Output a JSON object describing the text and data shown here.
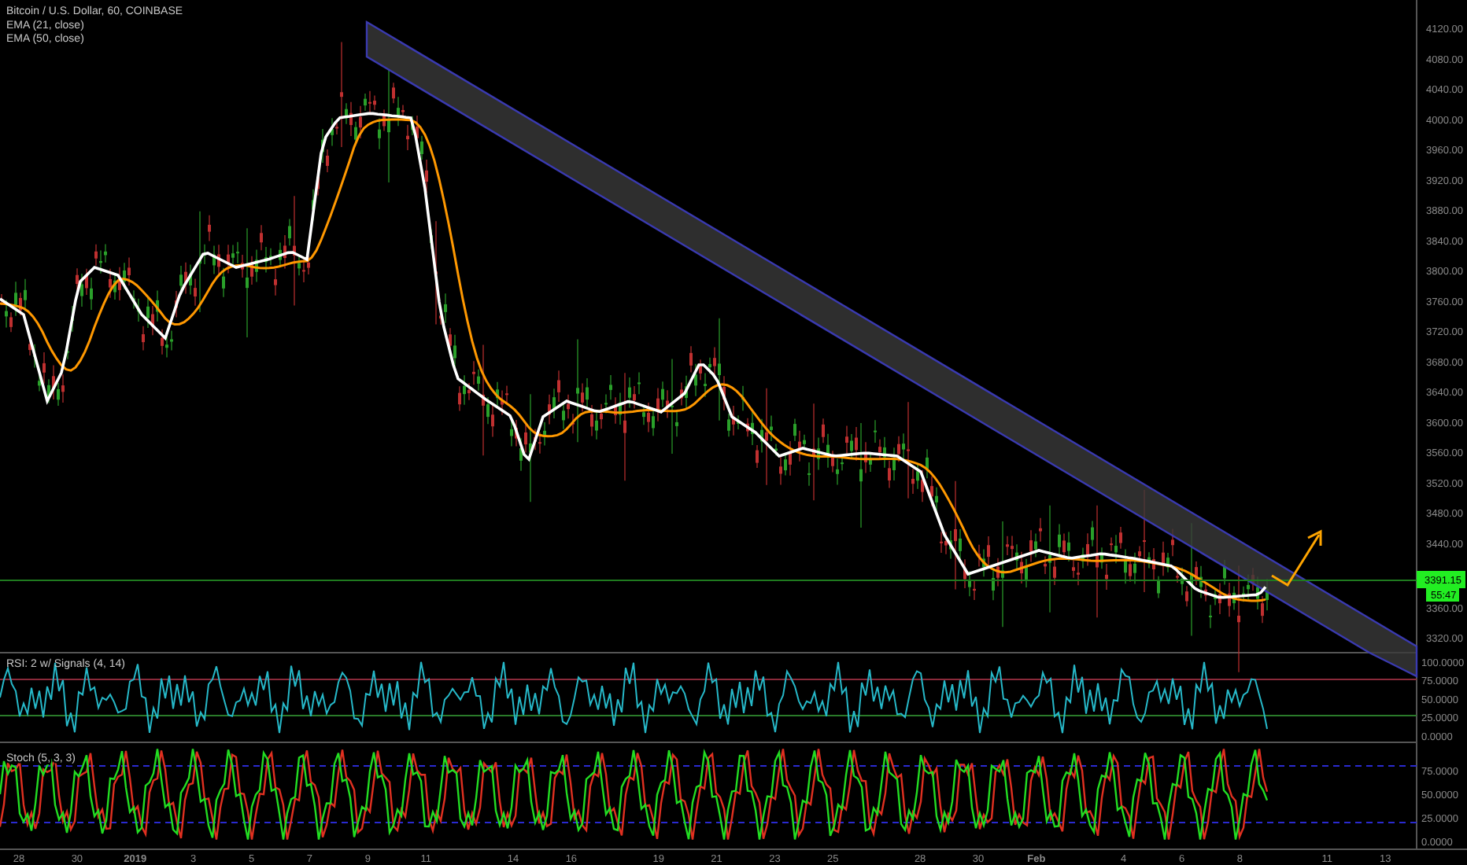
{
  "legend": {
    "title": "Bitcoin / U.S. Dollar, 60, COINBASE",
    "studies": [
      "EMA (21, close)",
      "EMA (50, close)"
    ]
  },
  "price_axis": {
    "labels": [
      "4120.00",
      "4080.00",
      "4040.00",
      "4000.00",
      "3960.00",
      "3920.00",
      "3880.00",
      "3840.00",
      "3800.00",
      "3760.00",
      "3720.00",
      "3680.00",
      "3640.00",
      "3600.00",
      "3560.00",
      "3520.00",
      "3480.00",
      "3440.00",
      "3360.00",
      "3320.00"
    ]
  },
  "price_tag": {
    "price": "3391.15",
    "countdown": "55:47"
  },
  "rsi": {
    "title": "RSI: 2 w/ Signals (4, 14)",
    "axis_labels": [
      "100.0000",
      "75.0000",
      "50.0000",
      "25.0000",
      "0.0000"
    ]
  },
  "stoch": {
    "title": "Stoch (5, 3, 3)",
    "axis_labels": [
      "75.0000",
      "50.0000",
      "25.0000",
      "0.0000"
    ]
  },
  "time_axis": {
    "labels": [
      "28",
      "30",
      "2019",
      "3",
      "5",
      "7",
      "9",
      "11",
      "14",
      "16",
      "19",
      "21",
      "23",
      "25",
      "28",
      "30",
      "Feb",
      "4",
      "6",
      "8",
      "11",
      "13"
    ]
  }
}
